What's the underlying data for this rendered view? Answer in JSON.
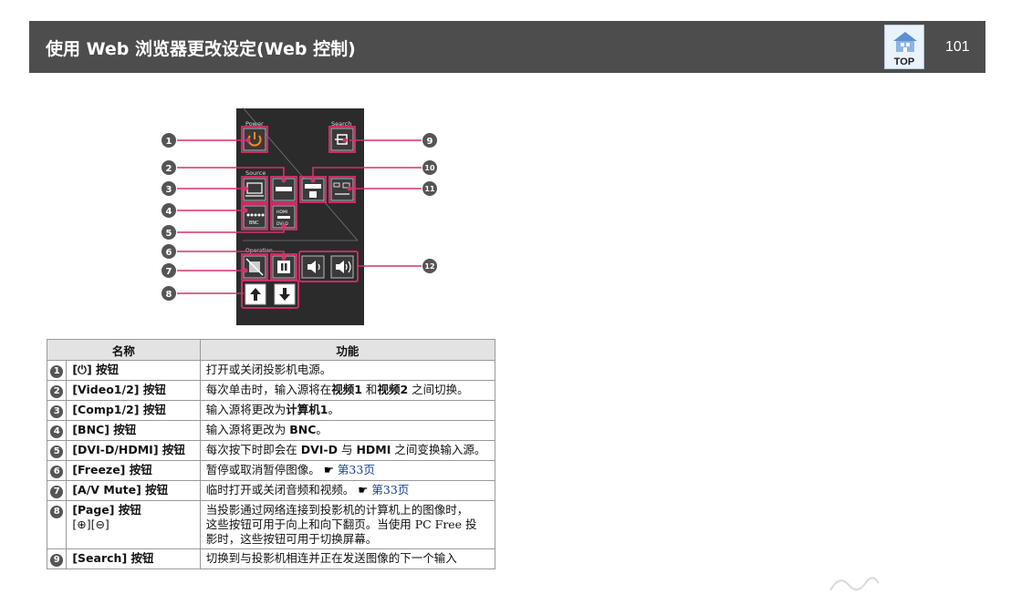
{
  "header": {
    "title": "使用 Web 浏览器更改设定(Web 控制)",
    "top_label": "TOP",
    "page_number": "101"
  },
  "diagram": {
    "labels": {
      "power": "Power",
      "search": "Search",
      "source": "Source",
      "operation": "Operation",
      "bnc": "BNC",
      "hdmi": "HDMI",
      "dvi": "DVI-D"
    },
    "callouts": [
      "1",
      "2",
      "3",
      "4",
      "5",
      "6",
      "7",
      "8",
      "9",
      "10",
      "11",
      "12"
    ]
  },
  "table": {
    "headers": [
      "名称",
      "功能"
    ],
    "rows": [
      {
        "num": "1",
        "name": "[⏻] 按钮",
        "name_sub": "",
        "func": [
          "打开或关闭投影机电源。"
        ],
        "ref": ""
      },
      {
        "num": "2",
        "name": "[Video1/2] 按钮",
        "name_sub": "",
        "func_parts": [
          "每次单击时，输入源将在",
          "视频1",
          "和",
          "视频2",
          "之间切换。"
        ],
        "ref": ""
      },
      {
        "num": "3",
        "name": "[Comp1/2] 按钮",
        "name_sub": "",
        "func_parts": [
          "输入源将更改为",
          "计算机1",
          "。"
        ],
        "ref": ""
      },
      {
        "num": "4",
        "name": "[BNC] 按钮",
        "name_sub": "",
        "func_parts": [
          "输入源将更改为",
          "BNC",
          "。"
        ],
        "ref": ""
      },
      {
        "num": "5",
        "name": "[DVI-D/HDMI] 按钮",
        "name_sub": "",
        "func_parts": [
          "每次按下时即会在",
          "DVI-D",
          "与",
          "HDMI",
          "之间变换输入源。"
        ],
        "ref": ""
      },
      {
        "num": "6",
        "name": "[Freeze] 按钮",
        "name_sub": "",
        "func": [
          "暂停或取消暂停图像。"
        ],
        "ref": "第33页"
      },
      {
        "num": "7",
        "name": "[A/V Mute] 按钮",
        "name_sub": "",
        "func": [
          "临时打开或关闭音频和视频。"
        ],
        "ref": "第33页"
      },
      {
        "num": "8",
        "name": "[Page] 按钮",
        "name_sub": "[⊕][⊖]",
        "func": [
          "当投影通过网络连接到投影机的计算机上的图像时，",
          "这些按钮可用于向上和向下翻页。当使用 PC Free 投",
          "影时，这些按钮可用于切换屏幕。"
        ],
        "ref": ""
      },
      {
        "num": "9",
        "name": "[Search] 按钮",
        "name_sub": "",
        "func": [
          "切换到与投影机相连并正在发送图像的下一个输入"
        ],
        "ref": ""
      }
    ]
  },
  "colors": {
    "header_bg": "#4d4d4d",
    "accent_pink": "#d6306e",
    "power_orange": "#f08a24",
    "panel_bg": "#2b2b2b",
    "link": "#1a3f9a"
  }
}
